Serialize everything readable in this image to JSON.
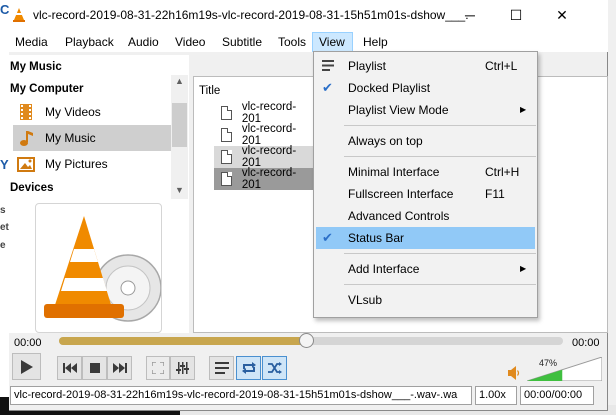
{
  "window": {
    "title": "vlc-record-2019-08-31-22h16m19s-vlc-record-2019-08-31-15h51m01s-dshow___.",
    "minimize_glyph": "─",
    "maximize_glyph": "☐",
    "close_glyph": "✕"
  },
  "menubar": [
    "Media",
    "Playback",
    "Audio",
    "Video",
    "Subtitle",
    "Tools",
    "View",
    "Help"
  ],
  "sidebar": {
    "my_music_header": "My Music",
    "my_computer_header": "My Computer",
    "items": [
      {
        "label": "My Videos",
        "icon": "film-icon"
      },
      {
        "label": "My Music",
        "icon": "music-note-icon"
      },
      {
        "label": "My Pictures",
        "icon": "picture-icon"
      }
    ],
    "devices_header": "Devices"
  },
  "playlist": {
    "column_header": "Title",
    "rows": [
      "vlc-record-201",
      "vlc-record-201",
      "vlc-record-201",
      "vlc-record-201"
    ]
  },
  "view_menu": {
    "items": [
      {
        "label": "Playlist",
        "shortcut": "Ctrl+L",
        "icon": "playlist-icon"
      },
      {
        "label": "Docked Playlist",
        "checked": true
      },
      {
        "label": "Playlist View Mode",
        "submenu": true
      },
      {
        "label": "Always on top"
      },
      {
        "label": "Minimal Interface",
        "shortcut": "Ctrl+H"
      },
      {
        "label": "Fullscreen Interface",
        "shortcut": "F11"
      },
      {
        "label": "Advanced Controls"
      },
      {
        "label": "Status Bar",
        "checked": true
      },
      {
        "label": "Add Interface",
        "submenu": true
      },
      {
        "label": "VLsub"
      }
    ]
  },
  "seek": {
    "elapsed": "00:00",
    "remaining": "00:00",
    "position_fraction": 0.49
  },
  "volume": {
    "percent_text": "47%",
    "level": 0.47
  },
  "status_bar": {
    "filename": "vlc-record-2019-08-31-22h16m19s-vlc-record-2019-08-31-15h51m01s-dshow___-.wav-.wa",
    "speed": "1.00x",
    "time": "00:00/00:00"
  },
  "colors": {
    "accent": "#2b6fc8",
    "menu_highlight": "#91c9f7",
    "seek_fill": "#c8a64e",
    "volume_fill": "#3fbf3f"
  }
}
